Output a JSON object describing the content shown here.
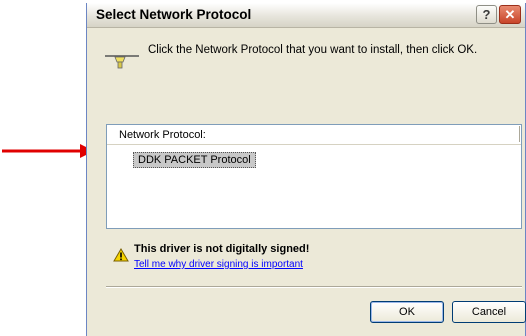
{
  "dialog": {
    "title": "Select Network Protocol",
    "help_label": "?",
    "close_label": "✕",
    "instruction": "Click the Network Protocol that you want to install, then click OK.",
    "list": {
      "header": "Network Protocol:",
      "items": [
        {
          "label": "DDK PACKET Protocol",
          "selected": true
        }
      ]
    },
    "warning": {
      "title": "This driver is not digitally signed!",
      "link": "Tell me why driver signing is important"
    },
    "buttons": {
      "ok": "OK",
      "cancel": "Cancel"
    }
  },
  "icons": {
    "instruction": "network-connector-icon",
    "warning": "warning-icon",
    "annotation": "red-arrow-icon"
  },
  "colors": {
    "arrow": "#e00000",
    "window_bg": "#ece9d8",
    "selection": "#c8c8c8",
    "link": "#0000ff"
  }
}
